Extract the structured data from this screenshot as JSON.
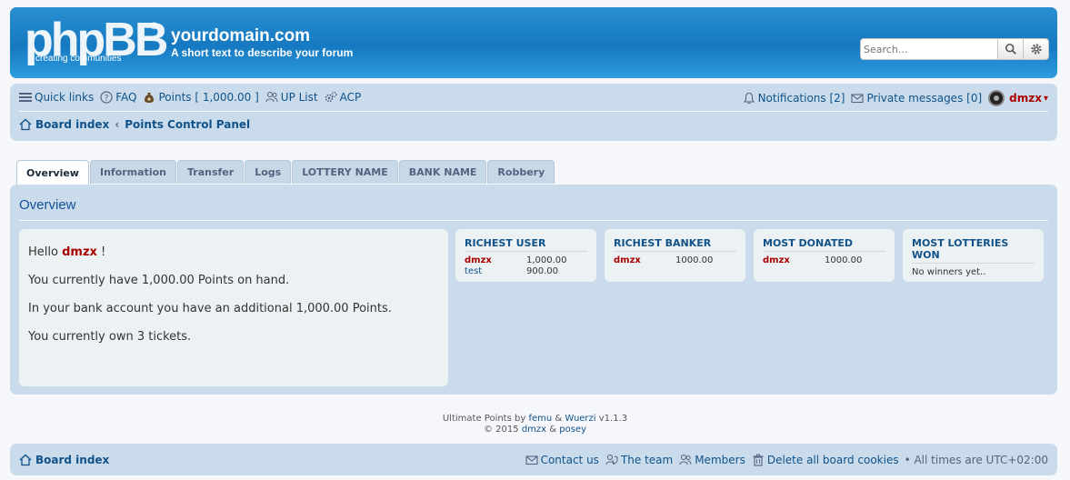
{
  "header": {
    "logo_text": "phpBB",
    "logo_reg": "®",
    "logo_tagline": "creating communities",
    "site_title": "yourdomain.com",
    "site_description": "A short text to describe your forum",
    "search_placeholder": "Search…"
  },
  "navbar": {
    "quick_links": "Quick links",
    "faq": "FAQ",
    "points": "Points [ 1,000.00 ]",
    "up_list": "UP List",
    "acp": "ACP",
    "notifications": "Notifications [2]",
    "private_messages": "Private messages [0]",
    "username": "dmzx",
    "dropdown_caret": "▾"
  },
  "breadcrumbs": {
    "board_index": "Board index",
    "separator": "‹",
    "current": "Points Control Panel"
  },
  "tabs": [
    {
      "label": "Overview",
      "active": true
    },
    {
      "label": "Information",
      "active": false
    },
    {
      "label": "Transfer",
      "active": false
    },
    {
      "label": "Logs",
      "active": false
    },
    {
      "label": "LOTTERY NAME",
      "active": false
    },
    {
      "label": "BANK NAME",
      "active": false
    },
    {
      "label": "Robbery",
      "active": false
    }
  ],
  "overview": {
    "title": "Overview",
    "hello_prefix": "Hello",
    "hello_user": "dmzx",
    "hello_suffix": "!",
    "line_points": "You currently have 1,000.00 Points on hand.",
    "line_bank": "In your bank account you have an additional 1,000.00 Points.",
    "line_tickets": "You currently own 3 tickets."
  },
  "stats": {
    "richest_user": {
      "title": "RICHEST USER",
      "rows": [
        {
          "user": "dmzx",
          "value": "1,000.00"
        },
        {
          "user": "test",
          "value": "900.00"
        }
      ]
    },
    "richest_banker": {
      "title": "RICHEST BANKER",
      "rows": [
        {
          "user": "dmzx",
          "value": "1000.00"
        }
      ]
    },
    "most_donated": {
      "title": "MOST DONATED",
      "rows": [
        {
          "user": "dmzx",
          "value": "1000.00"
        }
      ]
    },
    "most_lotteries": {
      "title": "MOST LOTTERIES WON",
      "empty": "No winners yet.."
    }
  },
  "credits": {
    "prefix": "Ultimate Points by",
    "author1": "femu",
    "amp": "&",
    "author2": "Wuerzi",
    "version": "v1.1.3",
    "copy": "© 2015",
    "copy_a1": "dmzx",
    "copy_a2": "posey"
  },
  "footer": {
    "board_index": "Board index",
    "contact": "Contact us",
    "team": "The team",
    "members": "Members",
    "delete_cookies": "Delete all board cookies",
    "times": "• All times are UTC+02:00"
  },
  "colors": {
    "header_blue": "#1679c1",
    "nav_bg": "#cadceb",
    "link": "#105289",
    "user_red": "#aa0000"
  }
}
